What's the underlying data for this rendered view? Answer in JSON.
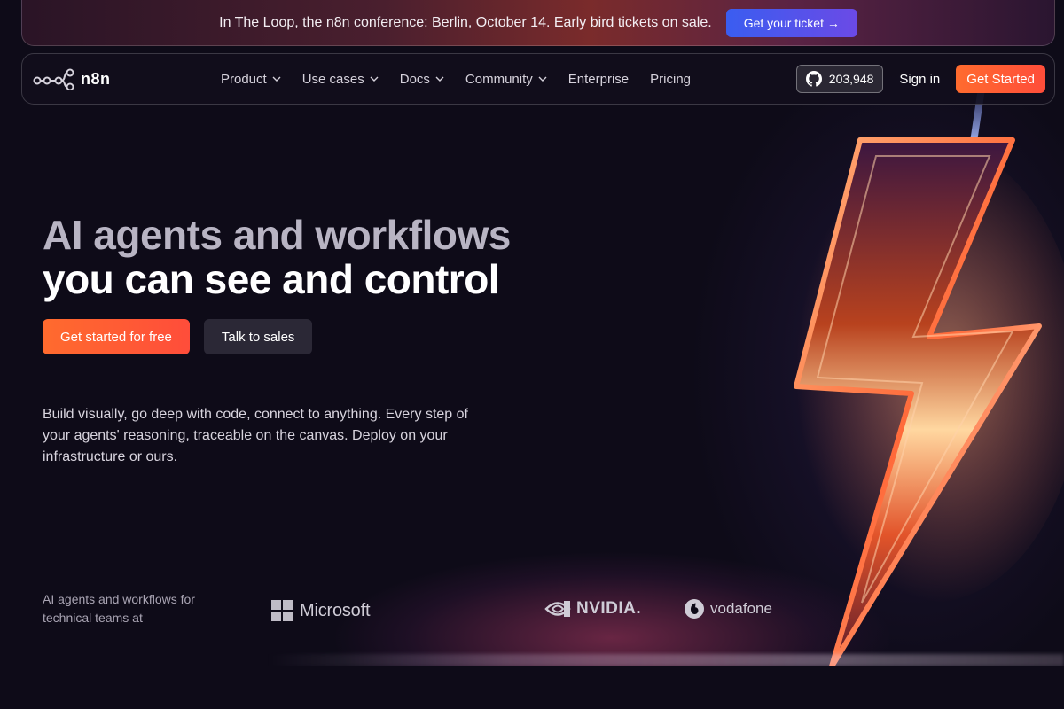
{
  "banner": {
    "text": "In The Loop, the n8n conference: Berlin, October 14. Early bird tickets on sale.",
    "cta_label": "Get your ticket →"
  },
  "nav": {
    "logo_text": "n8n",
    "links": [
      {
        "label": "Product",
        "has_dropdown": true
      },
      {
        "label": "Use cases",
        "has_dropdown": true
      },
      {
        "label": "Docs",
        "has_dropdown": true
      },
      {
        "label": "Community",
        "has_dropdown": true
      },
      {
        "label": "Enterprise",
        "has_dropdown": false
      },
      {
        "label": "Pricing",
        "has_dropdown": false
      }
    ],
    "github_stars": "203,948",
    "signin_label": "Sign in",
    "cta_label": "Get Started"
  },
  "hero": {
    "title_line1": "AI agents and workflows",
    "title_line2": "you can see and control",
    "primary_cta": "Get started for free",
    "secondary_cta": "Talk to sales",
    "description": "Build visually, go deep with code, connect to anything. Every step of your agents' reasoning, traceable on the canvas. Deploy on your infrastructure or ours."
  },
  "trusted": {
    "text": "AI agents and workflows for technical teams at",
    "logos": [
      "Microsoft",
      "NVIDIA.",
      "vodafone"
    ]
  },
  "colors": {
    "background": "#0e0b18",
    "accent_orange": "#ff5a34",
    "banner_button": "#4a56ec"
  }
}
